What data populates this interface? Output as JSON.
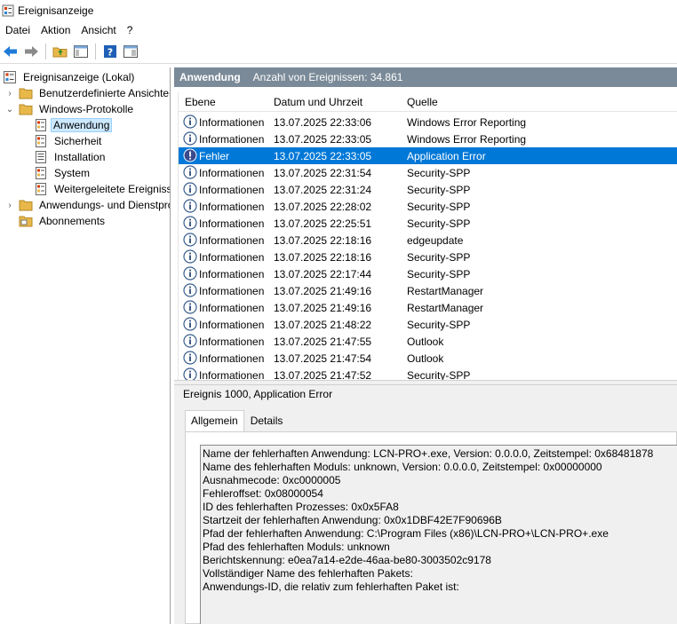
{
  "window": {
    "title": "Ereignisanzeige"
  },
  "menu": [
    "Datei",
    "Aktion",
    "Ansicht",
    "?"
  ],
  "tree": {
    "root": "Ereignisanzeige (Lokal)",
    "custom_views": "Benutzerdefinierte Ansichten",
    "windows_logs": "Windows-Protokolle",
    "logs": [
      "Anwendung",
      "Sicherheit",
      "Installation",
      "System",
      "Weitergeleitete Ereignisse"
    ],
    "app_services": "Anwendungs- und Dienstprotokolle",
    "subscriptions": "Abonnements"
  },
  "pane": {
    "title": "Anwendung",
    "count_text": "Anzahl von Ereignissen: 34.861"
  },
  "columns": {
    "level": "Ebene",
    "date": "Datum und Uhrzeit",
    "source": "Quelle"
  },
  "events": [
    {
      "level": "Informationen",
      "date": "13.07.2025 22:33:06",
      "source": "Windows Error Reporting",
      "type": "info"
    },
    {
      "level": "Informationen",
      "date": "13.07.2025 22:33:05",
      "source": "Windows Error Reporting",
      "type": "info"
    },
    {
      "level": "Fehler",
      "date": "13.07.2025 22:33:05",
      "source": "Application Error",
      "type": "error",
      "selected": true
    },
    {
      "level": "Informationen",
      "date": "13.07.2025 22:31:54",
      "source": "Security-SPP",
      "type": "info"
    },
    {
      "level": "Informationen",
      "date": "13.07.2025 22:31:24",
      "source": "Security-SPP",
      "type": "info"
    },
    {
      "level": "Informationen",
      "date": "13.07.2025 22:28:02",
      "source": "Security-SPP",
      "type": "info"
    },
    {
      "level": "Informationen",
      "date": "13.07.2025 22:25:51",
      "source": "Security-SPP",
      "type": "info"
    },
    {
      "level": "Informationen",
      "date": "13.07.2025 22:18:16",
      "source": "edgeupdate",
      "type": "info"
    },
    {
      "level": "Informationen",
      "date": "13.07.2025 22:18:16",
      "source": "Security-SPP",
      "type": "info"
    },
    {
      "level": "Informationen",
      "date": "13.07.2025 22:17:44",
      "source": "Security-SPP",
      "type": "info"
    },
    {
      "level": "Informationen",
      "date": "13.07.2025 21:49:16",
      "source": "RestartManager",
      "type": "info"
    },
    {
      "level": "Informationen",
      "date": "13.07.2025 21:49:16",
      "source": "RestartManager",
      "type": "info"
    },
    {
      "level": "Informationen",
      "date": "13.07.2025 21:48:22",
      "source": "Security-SPP",
      "type": "info"
    },
    {
      "level": "Informationen",
      "date": "13.07.2025 21:47:55",
      "source": "Outlook",
      "type": "info"
    },
    {
      "level": "Informationen",
      "date": "13.07.2025 21:47:54",
      "source": "Outlook",
      "type": "info"
    },
    {
      "level": "Informationen",
      "date": "13.07.2025 21:47:52",
      "source": "Security-SPP",
      "type": "info"
    }
  ],
  "detail": {
    "title": "Ereignis 1000, Application Error",
    "tabs": [
      "Allgemein",
      "Details"
    ],
    "lines": [
      "Name der fehlerhaften Anwendung: LCN-PRO+.exe, Version: 0.0.0.0, Zeitstempel: 0x68481878",
      "Name des fehlerhaften Moduls: unknown, Version: 0.0.0.0, Zeitstempel: 0x00000000",
      "Ausnahmecode: 0xc0000005",
      "Fehleroffset: 0x08000054",
      "ID des fehlerhaften Prozesses: 0x0x5FA8",
      "Startzeit der fehlerhaften Anwendung: 0x0x1DBF42E7F90696B",
      "Pfad der fehlerhaften Anwendung: C:\\Program Files (x86)\\LCN-PRO+\\LCN-PRO+.exe",
      "Pfad des fehlerhaften Moduls: unknown",
      "Berichtskennung: e0ea7a14-e2de-46aa-be80-3003502c9178",
      "Vollständiger Name des fehlerhaften Pakets:",
      "Anwendungs-ID, die relativ zum fehlerhaften Paket ist:"
    ]
  },
  "colors": {
    "selection": "#0078d7",
    "header": "#7a8a98",
    "tree_selected": "#cce8ff"
  }
}
